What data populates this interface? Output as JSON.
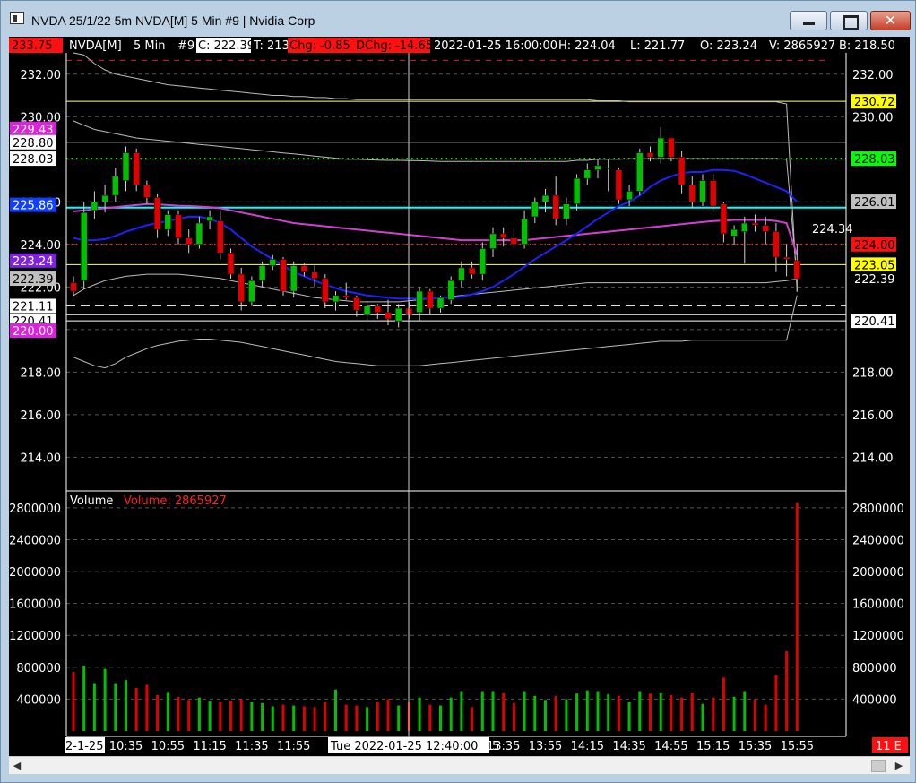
{
  "window": {
    "title": "NVDA 25/1/22 5m NVDA[M]  5 Min   #9 | Nvidia Corp",
    "close_glyph": "✕"
  },
  "colors": {
    "background": "#000000",
    "up_candle": "#00c000",
    "down_candle": "#e00000",
    "ma_blue": "#2020ff",
    "ma_magenta": "#d040d0",
    "cyan_line": "#00ffff",
    "yellow_line": "#ffff80"
  },
  "header": {
    "last_price_badge": "233.75",
    "symbol": "NVDA[M]",
    "interval": "5 Min",
    "bar_no": "#9",
    "close": "C: 222.39",
    "ticks": "T: 213",
    "change": "Chg: -0.85",
    "day_change": "DChg: -14.65",
    "datetime": "2022-01-25 16:00:00",
    "high": "H: 224.04",
    "low": "L: 221.77",
    "open": "O: 223.24",
    "volume": "V: 2865927",
    "bid": "B: 218.50"
  },
  "left_axis_labels": [
    {
      "text": "232.00",
      "value": 232
    },
    {
      "text": "230.00",
      "value": 230
    },
    {
      "text": "226.00",
      "value": 226
    },
    {
      "text": "224.00",
      "value": 224
    },
    {
      "text": "222.00",
      "value": 222
    },
    {
      "text": "218.00",
      "value": 218
    },
    {
      "text": "216.00",
      "value": 216
    },
    {
      "text": "214.00",
      "value": 214
    }
  ],
  "left_badges": [
    {
      "text": "229.43",
      "value": 229.43,
      "bg": "#e020e0",
      "fg": "#ffffff"
    },
    {
      "text": "228.80",
      "value": 228.8,
      "bg": "#ffffff",
      "fg": "#000000"
    },
    {
      "text": "228.03",
      "value": 228.03,
      "bg": "#ffffff",
      "fg": "#000000"
    },
    {
      "text": "225.86",
      "value": 225.86,
      "bg": "#1040ff",
      "fg": "#ffffff"
    },
    {
      "text": "223.24",
      "value": 223.24,
      "bg": "#8020e0",
      "fg": "#ffffff"
    },
    {
      "text": "222.39",
      "value": 222.39,
      "bg": "#c0c0c0",
      "fg": "#000000"
    },
    {
      "text": "221.11",
      "value": 221.11,
      "bg": "#ffffff",
      "fg": "#000000"
    },
    {
      "text": "220.41",
      "value": 220.41,
      "bg": "#ffffff",
      "fg": "#000000"
    },
    {
      "text": "220.00",
      "value": 219.95,
      "bg": "#e020e0",
      "fg": "#ffffff"
    }
  ],
  "right_axis_labels": [
    {
      "text": "232.00",
      "value": 232
    },
    {
      "text": "230.00",
      "value": 230
    },
    {
      "text": "218.00",
      "value": 218
    },
    {
      "text": "216.00",
      "value": 216
    },
    {
      "text": "214.00",
      "value": 214
    }
  ],
  "right_badges": [
    {
      "text": "230.72",
      "value": 230.72,
      "bg": "#ffff00",
      "fg": "#000000"
    },
    {
      "text": "228.03",
      "value": 228.03,
      "bg": "#00ff00",
      "fg": "#000000"
    },
    {
      "text": "226.01",
      "value": 226.01,
      "bg": "#c0c0c0",
      "fg": "#000000"
    },
    {
      "text": "224.00",
      "value": 224.0,
      "bg": "#ff1010",
      "fg": "#000000"
    },
    {
      "text": "223.05",
      "value": 223.05,
      "bg": "#ffff00",
      "fg": "#000000"
    },
    {
      "text": "222.39",
      "value": 222.39,
      "bg": "#000000",
      "fg": "#ffffff"
    },
    {
      "text": "220.41",
      "value": 220.41,
      "bg": "#ffffff",
      "fg": "#000000"
    }
  ],
  "last_price_annotation": "224.34",
  "volume_panel": {
    "title": "Volume",
    "value_label": "Volume: 2865927",
    "left_labels": [
      "2800000",
      "2400000",
      "2000000",
      "1600000",
      "1200000",
      "800000",
      "400000"
    ],
    "right_labels": [
      "2800000",
      "2400000",
      "2000000",
      "1600000",
      "1200000",
      "800000",
      "400000"
    ]
  },
  "time_axis": {
    "labels": [
      "10:35",
      "10:55",
      "11:15",
      "11:35",
      "11:55",
      "13:35",
      "13:55",
      "14:15",
      "14:35",
      "14:55",
      "15:15",
      "15:35",
      "15:55"
    ],
    "left_date": "2-1-25",
    "cursor_datetime": "Tue 2022-01-25  12:40:00",
    "partial_label": "5",
    "right_badge": "11 E"
  },
  "horizontal_lines": {
    "yellow_top": 230.72,
    "white_1": 228.8,
    "green_dotted": 228.03,
    "cyan": 225.73,
    "red_dotted": 224.0,
    "yellow_low": 223.05,
    "dashed_white": 221.11,
    "white_2": 220.7,
    "white_3": 220.41,
    "red_dashed_top": 232.65
  },
  "scroll": {
    "left_arrow": "◀",
    "right_arrow": "▶"
  },
  "chart_data": {
    "type": "candlestick",
    "price_axis": {
      "min": 212.5,
      "max": 233.0
    },
    "volume_axis": {
      "min": 0,
      "max": 2900000
    },
    "candles": [
      {
        "o": 222.2,
        "h": 222.5,
        "l": 221.6,
        "c": 221.8,
        "v": 740000
      },
      {
        "o": 222.3,
        "h": 226.0,
        "l": 221.9,
        "c": 225.5,
        "v": 820000
      },
      {
        "o": 225.6,
        "h": 226.5,
        "l": 225.2,
        "c": 226.0,
        "v": 600000
      },
      {
        "o": 226.0,
        "h": 226.8,
        "l": 225.5,
        "c": 226.3,
        "v": 780000
      },
      {
        "o": 226.3,
        "h": 227.6,
        "l": 226.0,
        "c": 227.2,
        "v": 600000
      },
      {
        "o": 227.0,
        "h": 228.6,
        "l": 226.5,
        "c": 228.3,
        "v": 640000
      },
      {
        "o": 228.3,
        "h": 228.5,
        "l": 226.5,
        "c": 226.8,
        "v": 540000
      },
      {
        "o": 226.8,
        "h": 227.0,
        "l": 225.9,
        "c": 226.2,
        "v": 580000
      },
      {
        "o": 226.2,
        "h": 226.4,
        "l": 224.3,
        "c": 224.7,
        "v": 450000
      },
      {
        "o": 224.7,
        "h": 225.6,
        "l": 224.4,
        "c": 225.4,
        "v": 490000
      },
      {
        "o": 225.4,
        "h": 225.6,
        "l": 224.0,
        "c": 224.3,
        "v": 430000
      },
      {
        "o": 224.3,
        "h": 224.7,
        "l": 223.6,
        "c": 224.0,
        "v": 390000
      },
      {
        "o": 224.0,
        "h": 225.3,
        "l": 223.8,
        "c": 225.0,
        "v": 420000
      },
      {
        "o": 225.1,
        "h": 225.6,
        "l": 224.7,
        "c": 225.3,
        "v": 370000
      },
      {
        "o": 225.1,
        "h": 225.6,
        "l": 223.3,
        "c": 223.6,
        "v": 360000
      },
      {
        "o": 223.6,
        "h": 223.8,
        "l": 222.4,
        "c": 222.6,
        "v": 380000
      },
      {
        "o": 222.6,
        "h": 222.9,
        "l": 220.9,
        "c": 221.3,
        "v": 400000
      },
      {
        "o": 221.3,
        "h": 222.5,
        "l": 221.1,
        "c": 222.3,
        "v": 360000
      },
      {
        "o": 222.3,
        "h": 223.2,
        "l": 222.0,
        "c": 223.0,
        "v": 350000
      },
      {
        "o": 223.0,
        "h": 223.5,
        "l": 222.8,
        "c": 223.3,
        "v": 310000
      },
      {
        "o": 223.3,
        "h": 223.4,
        "l": 221.6,
        "c": 221.8,
        "v": 330000
      },
      {
        "o": 221.8,
        "h": 223.2,
        "l": 221.5,
        "c": 223.0,
        "v": 320000
      },
      {
        "o": 223.0,
        "h": 223.1,
        "l": 222.5,
        "c": 222.7,
        "v": 310000
      },
      {
        "o": 222.7,
        "h": 223.0,
        "l": 222.0,
        "c": 222.4,
        "v": 300000
      },
      {
        "o": 222.4,
        "h": 222.6,
        "l": 221.0,
        "c": 221.3,
        "v": 360000
      },
      {
        "o": 221.3,
        "h": 221.8,
        "l": 220.9,
        "c": 221.6,
        "v": 520000
      },
      {
        "o": 221.6,
        "h": 222.2,
        "l": 221.4,
        "c": 221.5,
        "v": 330000
      },
      {
        "o": 221.5,
        "h": 221.6,
        "l": 220.6,
        "c": 220.9,
        "v": 320000
      },
      {
        "o": 220.7,
        "h": 221.3,
        "l": 220.4,
        "c": 221.1,
        "v": 300000
      },
      {
        "o": 221.1,
        "h": 221.2,
        "l": 220.5,
        "c": 220.8,
        "v": 360000
      },
      {
        "o": 220.8,
        "h": 221.4,
        "l": 220.2,
        "c": 220.5,
        "v": 400000
      },
      {
        "o": 220.4,
        "h": 221.2,
        "l": 220.1,
        "c": 221.0,
        "v": 320000
      },
      {
        "o": 221.0,
        "h": 221.3,
        "l": 220.5,
        "c": 220.7,
        "v": 360000
      },
      {
        "o": 220.8,
        "h": 222.0,
        "l": 220.4,
        "c": 221.8,
        "v": 420000
      },
      {
        "o": 221.8,
        "h": 221.9,
        "l": 220.7,
        "c": 221.0,
        "v": 330000
      },
      {
        "o": 221.0,
        "h": 221.6,
        "l": 220.8,
        "c": 221.5,
        "v": 320000
      },
      {
        "o": 221.4,
        "h": 222.5,
        "l": 221.2,
        "c": 222.3,
        "v": 420000
      },
      {
        "o": 222.3,
        "h": 223.2,
        "l": 222.0,
        "c": 222.9,
        "v": 500000
      },
      {
        "o": 222.9,
        "h": 223.2,
        "l": 222.4,
        "c": 222.6,
        "v": 300000
      },
      {
        "o": 222.6,
        "h": 224.1,
        "l": 222.3,
        "c": 223.8,
        "v": 500000
      },
      {
        "o": 223.8,
        "h": 224.8,
        "l": 223.4,
        "c": 224.5,
        "v": 500000
      },
      {
        "o": 224.5,
        "h": 224.8,
        "l": 223.9,
        "c": 224.3,
        "v": 480000
      },
      {
        "o": 224.3,
        "h": 224.8,
        "l": 223.8,
        "c": 224.0,
        "v": 350000
      },
      {
        "o": 224.0,
        "h": 225.6,
        "l": 223.8,
        "c": 225.2,
        "v": 500000
      },
      {
        "o": 225.3,
        "h": 226.2,
        "l": 225.0,
        "c": 226.0,
        "v": 440000
      },
      {
        "o": 226.0,
        "h": 226.6,
        "l": 225.5,
        "c": 226.3,
        "v": 390000
      },
      {
        "o": 226.3,
        "h": 227.2,
        "l": 224.9,
        "c": 225.2,
        "v": 440000
      },
      {
        "o": 225.2,
        "h": 226.2,
        "l": 224.9,
        "c": 225.9,
        "v": 400000
      },
      {
        "o": 225.9,
        "h": 227.3,
        "l": 225.6,
        "c": 227.1,
        "v": 470000
      },
      {
        "o": 227.1,
        "h": 227.8,
        "l": 226.8,
        "c": 227.5,
        "v": 510000
      },
      {
        "o": 227.5,
        "h": 228.0,
        "l": 227.1,
        "c": 227.7,
        "v": 500000
      },
      {
        "o": 227.6,
        "h": 228.0,
        "l": 226.5,
        "c": 227.6,
        "v": 460000
      },
      {
        "o": 227.5,
        "h": 227.6,
        "l": 225.9,
        "c": 226.1,
        "v": 440000
      },
      {
        "o": 226.1,
        "h": 226.8,
        "l": 225.8,
        "c": 226.5,
        "v": 360000
      },
      {
        "o": 226.5,
        "h": 228.5,
        "l": 226.3,
        "c": 228.3,
        "v": 500000
      },
      {
        "o": 228.3,
        "h": 228.6,
        "l": 227.9,
        "c": 228.1,
        "v": 470000
      },
      {
        "o": 228.1,
        "h": 229.5,
        "l": 227.8,
        "c": 229.0,
        "v": 480000
      },
      {
        "o": 229.0,
        "h": 229.0,
        "l": 227.9,
        "c": 228.1,
        "v": 450000
      },
      {
        "o": 228.1,
        "h": 228.4,
        "l": 226.4,
        "c": 226.8,
        "v": 420000
      },
      {
        "o": 226.8,
        "h": 227.2,
        "l": 225.7,
        "c": 226.0,
        "v": 480000
      },
      {
        "o": 226.0,
        "h": 227.3,
        "l": 225.8,
        "c": 227.0,
        "v": 340000
      },
      {
        "o": 227.0,
        "h": 227.3,
        "l": 225.6,
        "c": 225.8,
        "v": 420000
      },
      {
        "o": 225.9,
        "h": 226.0,
        "l": 224.1,
        "c": 224.5,
        "v": 670000
      },
      {
        "o": 224.4,
        "h": 224.9,
        "l": 224.0,
        "c": 224.7,
        "v": 430000
      },
      {
        "o": 224.6,
        "h": 225.3,
        "l": 223.1,
        "c": 225.0,
        "v": 500000
      },
      {
        "o": 225.0,
        "h": 225.4,
        "l": 224.6,
        "c": 224.9,
        "v": 400000
      },
      {
        "o": 224.9,
        "h": 225.3,
        "l": 224.0,
        "c": 224.6,
        "v": 330000
      },
      {
        "o": 224.6,
        "h": 225.0,
        "l": 222.7,
        "c": 223.4,
        "v": 700000
      },
      {
        "o": 223.4,
        "h": 224.0,
        "l": 222.5,
        "c": 223.3,
        "v": 1000000
      },
      {
        "o": 223.24,
        "h": 224.04,
        "l": 221.77,
        "c": 222.39,
        "v": 2865927
      }
    ],
    "ma_blue": [
      224.3,
      224.2,
      224.2,
      224.25,
      224.4,
      224.6,
      224.75,
      224.9,
      225.0,
      225.1,
      225.2,
      225.3,
      225.3,
      225.2,
      225.0,
      224.7,
      224.3,
      223.9,
      223.6,
      223.3,
      223.0,
      222.7,
      222.5,
      222.3,
      222.1,
      221.95,
      221.8,
      221.7,
      221.6,
      221.55,
      221.5,
      221.45,
      221.45,
      221.45,
      221.45,
      221.5,
      221.5,
      221.55,
      221.65,
      221.8,
      222.0,
      222.3,
      222.6,
      222.95,
      223.3,
      223.6,
      223.9,
      224.2,
      224.5,
      224.85,
      225.2,
      225.5,
      225.8,
      226.0,
      226.3,
      226.7,
      227.0,
      227.2,
      227.35,
      227.4,
      227.4,
      227.5,
      227.5,
      227.45,
      227.3,
      227.1,
      226.9,
      226.7,
      226.5,
      226.0
    ],
    "ma_magenta": [
      225.55,
      225.6,
      225.65,
      225.7,
      225.75,
      225.8,
      225.85,
      225.9,
      225.88,
      225.85,
      225.82,
      225.8,
      225.78,
      225.75,
      225.7,
      225.6,
      225.5,
      225.4,
      225.3,
      225.2,
      225.1,
      225.0,
      224.95,
      224.9,
      224.85,
      224.8,
      224.75,
      224.7,
      224.65,
      224.6,
      224.55,
      224.5,
      224.45,
      224.4,
      224.35,
      224.3,
      224.25,
      224.2,
      224.2,
      224.2,
      224.2,
      224.2,
      224.2,
      224.2,
      224.25,
      224.3,
      224.35,
      224.4,
      224.45,
      224.5,
      224.55,
      224.6,
      224.65,
      224.7,
      224.75,
      224.8,
      224.85,
      224.9,
      224.95,
      225.0,
      225.05,
      225.1,
      225.12,
      225.15,
      225.15,
      225.15,
      225.15,
      225.1,
      225.0,
      223.5
    ],
    "band_upper": [
      233.0,
      232.9,
      232.5,
      232.2,
      232.0,
      231.9,
      231.8,
      231.7,
      231.6,
      231.5,
      231.45,
      231.4,
      231.35,
      231.3,
      231.25,
      231.2,
      231.15,
      231.1,
      231.05,
      231.0,
      231.0,
      230.95,
      230.95,
      230.9,
      230.9,
      230.85,
      230.85,
      230.8,
      230.8,
      230.8,
      230.8,
      230.8,
      230.8,
      230.8,
      230.8,
      230.8,
      230.8,
      230.8,
      230.8,
      230.8,
      230.8,
      230.8,
      230.8,
      230.8,
      230.8,
      230.8,
      230.8,
      230.8,
      230.8,
      230.8,
      230.75,
      230.75,
      230.75,
      230.7,
      230.7,
      230.7,
      230.7,
      230.7,
      230.7,
      230.7,
      230.7,
      230.7,
      230.7,
      230.7,
      230.7,
      230.7,
      230.7,
      230.7,
      230.6,
      221.8
    ],
    "band_mid_upper": [
      229.8,
      229.6,
      229.4,
      229.3,
      229.2,
      229.1,
      229.0,
      228.95,
      228.9,
      228.85,
      228.8,
      228.75,
      228.7,
      228.65,
      228.6,
      228.55,
      228.5,
      228.45,
      228.4,
      228.35,
      228.3,
      228.25,
      228.2,
      228.15,
      228.1,
      228.05,
      228.0,
      228.0,
      227.98,
      227.96,
      227.95,
      227.95,
      227.94,
      227.93,
      227.92,
      227.9,
      227.9,
      227.9,
      227.9,
      227.9,
      227.9,
      227.9,
      227.9,
      227.9,
      227.9,
      227.9,
      227.9,
      227.9,
      227.95,
      227.95,
      228.0,
      228.0,
      228.0,
      228.02,
      228.02,
      228.03,
      228.03,
      228.03,
      228.03,
      228.03,
      228.03,
      228.03,
      228.03,
      228.03,
      228.03,
      228.03,
      228.03,
      228.03,
      228.0,
      222.4
    ],
    "band_mid_lower": [
      221.6,
      221.9,
      222.1,
      222.3,
      222.4,
      222.5,
      222.55,
      222.6,
      222.6,
      222.6,
      222.6,
      222.55,
      222.5,
      222.45,
      222.4,
      222.3,
      222.2,
      222.1,
      222.0,
      221.9,
      221.8,
      221.7,
      221.6,
      221.5,
      221.45,
      221.4,
      221.35,
      221.3,
      221.3,
      221.3,
      221.3,
      221.3,
      221.35,
      221.4,
      221.45,
      221.5,
      221.55,
      221.6,
      221.65,
      221.7,
      221.75,
      221.8,
      221.85,
      221.9,
      221.95,
      222.0,
      222.05,
      222.1,
      222.15,
      222.2,
      222.2,
      222.2,
      222.2,
      222.2,
      222.2,
      222.2,
      222.2,
      222.2,
      222.2,
      222.2,
      222.2,
      222.2,
      222.2,
      222.2,
      222.2,
      222.2,
      222.2,
      222.25,
      222.3,
      222.39
    ],
    "band_lower": [
      218.7,
      218.5,
      218.3,
      218.2,
      218.4,
      218.7,
      218.9,
      219.1,
      219.25,
      219.35,
      219.45,
      219.5,
      219.55,
      219.55,
      219.5,
      219.45,
      219.4,
      219.3,
      219.2,
      219.1,
      219.0,
      218.9,
      218.8,
      218.7,
      218.6,
      218.5,
      218.45,
      218.4,
      218.35,
      218.3,
      218.3,
      218.3,
      218.3,
      218.3,
      218.35,
      218.4,
      218.45,
      218.5,
      218.55,
      218.6,
      218.65,
      218.7,
      218.75,
      218.8,
      218.85,
      218.9,
      218.95,
      219.0,
      219.05,
      219.1,
      219.15,
      219.2,
      219.25,
      219.3,
      219.35,
      219.4,
      219.45,
      219.45,
      219.45,
      219.5,
      219.5,
      219.5,
      219.5,
      219.5,
      219.5,
      219.5,
      219.5,
      219.5,
      219.5,
      221.6
    ]
  }
}
